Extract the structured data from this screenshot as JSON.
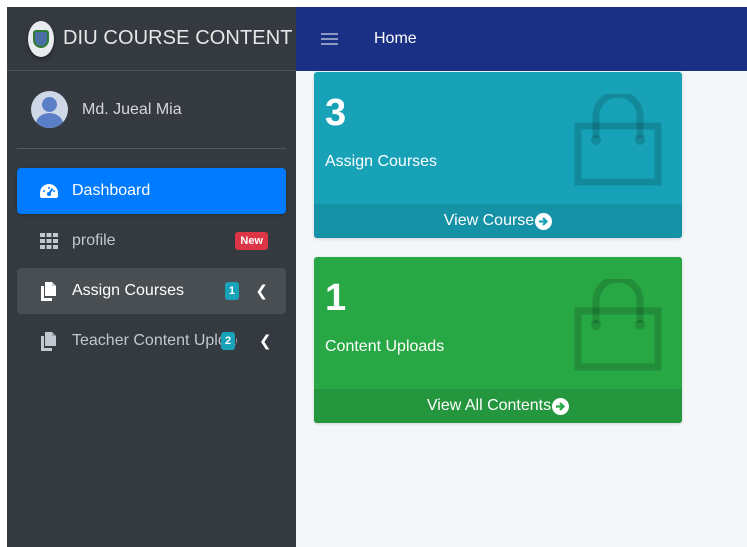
{
  "brand": {
    "title": "DIU COURSE CONTENT"
  },
  "user": {
    "name": "Md. Jueal Mia"
  },
  "topbar": {
    "home_label": "Home"
  },
  "nav": {
    "items": [
      {
        "label": "Dashboard",
        "icon": "dashboard-icon",
        "state": "active"
      },
      {
        "label": "profile",
        "icon": "grid-icon",
        "badge": "New",
        "badge_color": "#dc3545"
      },
      {
        "label": "Assign Courses",
        "icon": "copy-icon",
        "badge": "1",
        "badge_color": "#17a2b8",
        "state": "open"
      },
      {
        "label": "Teacher Content Upload",
        "icon": "copy-icon",
        "badge": "2",
        "badge_color": "#17a2b8"
      }
    ]
  },
  "cards": [
    {
      "count": "3",
      "label": "Assign Courses",
      "footer": "View Course",
      "color": "#17a2b8",
      "icon": "shopping-bag-icon"
    },
    {
      "count": "1",
      "label": "Content Uploads",
      "footer": "View All Contents",
      "color": "#28a745",
      "icon": "shopping-bag-icon"
    }
  ],
  "colors": {
    "sidebar": "#343a40",
    "topbar": "#1a3085",
    "active": "#007bff",
    "content_bg": "#f4f6f9"
  }
}
